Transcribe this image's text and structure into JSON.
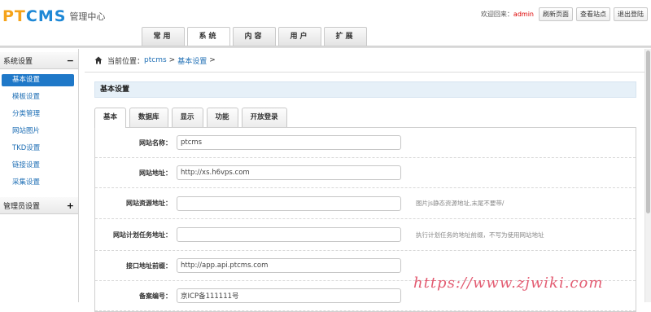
{
  "header": {
    "logo_text_p": "PT",
    "logo_text_cms": "CMS",
    "logo_sub": "管理中心",
    "welcome": "欢迎回来：",
    "username": "admin",
    "buttons": [
      "刷新页面",
      "查看站点",
      "退出登陆"
    ],
    "nav_tabs": [
      "常用",
      "系统",
      "内容",
      "用户",
      "扩展"
    ],
    "active_nav": 1
  },
  "sidebar": {
    "group1": {
      "title": "系统设置",
      "sign": "−"
    },
    "items": [
      "基本设置",
      "模板设置",
      "分类管理",
      "网站图片",
      "TKD设置",
      "链接设置",
      "采集设置"
    ],
    "active_item": 0,
    "group2": {
      "title": "管理员设置",
      "sign": "+"
    }
  },
  "breadcrumb": {
    "prefix": "当前位置：",
    "link1": "ptcms",
    "sep1": ">",
    "link2": "基本设置",
    "sep2": ">"
  },
  "section_title": "基本设置",
  "tabs": [
    "基本",
    "数据库",
    "显示",
    "功能",
    "开放登录"
  ],
  "active_tab": 0,
  "form": [
    {
      "label": "网站名称：",
      "value": "ptcms",
      "hint": ""
    },
    {
      "label": "网站地址：",
      "value": "http://xs.h6vps.com",
      "hint": ""
    },
    {
      "label": "网站资源地址：",
      "value": "",
      "hint": "图片js静态资源地址,末尾不要带/"
    },
    {
      "label": "网站计划任务地址：",
      "value": "",
      "hint": "执行计划任务的地址前缀，不写为使用网站地址"
    },
    {
      "label": "接口地址前缀：",
      "value": "http://app.api.ptcms.com",
      "hint": ""
    },
    {
      "label": "备案编号：",
      "value": "京ICP备111111号",
      "hint": ""
    }
  ],
  "watermark": "https://www.zjwiki.com",
  "colors": {
    "accent": "#1f78c8",
    "link": "#1f6fb5",
    "username": "#dd0000"
  }
}
